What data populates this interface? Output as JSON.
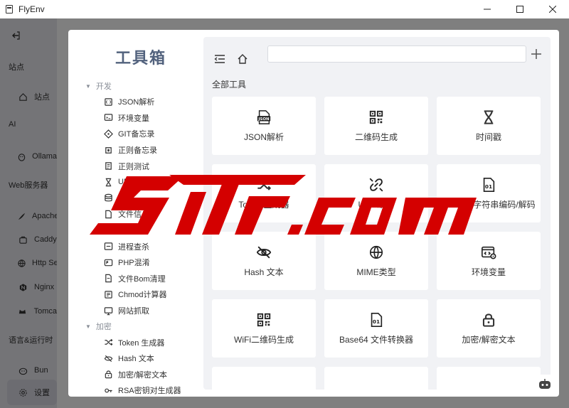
{
  "window": {
    "title": "FlyEnv"
  },
  "sidebar": {
    "items": [
      {
        "type": "icon",
        "icon": "back-icon"
      },
      {
        "type": "section",
        "label": "站点"
      },
      {
        "type": "item",
        "icon": "home-icon",
        "label": "站点"
      },
      {
        "type": "section",
        "label": "AI"
      },
      {
        "type": "item",
        "icon": "ollama-icon",
        "label": "Ollama"
      },
      {
        "type": "section",
        "label": "Web服务器"
      },
      {
        "type": "item",
        "icon": "apache-icon",
        "label": "Apache"
      },
      {
        "type": "item",
        "icon": "caddy-icon",
        "label": "Caddy"
      },
      {
        "type": "item",
        "icon": "globe-icon",
        "label": "Http Se"
      },
      {
        "type": "item",
        "icon": "nginx-icon",
        "label": "Nginx"
      },
      {
        "type": "item",
        "icon": "tomcat-icon",
        "label": "Tomca"
      },
      {
        "type": "section",
        "label": "语言&运行时"
      },
      {
        "type": "item",
        "icon": "bun-icon",
        "label": "Bun"
      },
      {
        "type": "item",
        "icon": "gear-icon",
        "label": "设置",
        "active": true
      }
    ]
  },
  "toolbox": {
    "title": "工具箱",
    "tree": [
      {
        "group": "开发",
        "items": [
          {
            "icon": "json-icon",
            "label": "JSON解析"
          },
          {
            "icon": "env-icon",
            "label": "环境变量"
          },
          {
            "icon": "git-icon",
            "label": "GIT备忘录"
          },
          {
            "icon": "regex-icon",
            "label": "正则备忘录"
          },
          {
            "icon": "regex-test-icon",
            "label": "正则测试"
          },
          {
            "icon": "hourglass-icon",
            "label": "UR"
          },
          {
            "icon": "db-icon",
            "label": ""
          },
          {
            "icon": "file-icon",
            "label": "文件信息"
          },
          {
            "icon": "port-icon",
            "label": ""
          },
          {
            "icon": "terminal-icon",
            "label": "进程查杀"
          },
          {
            "icon": "php-icon",
            "label": "PHP混淆"
          },
          {
            "icon": "bom-icon",
            "label": "文件Bom清理"
          },
          {
            "icon": "chmod-icon",
            "label": "Chmod计算器"
          },
          {
            "icon": "web-grab-icon",
            "label": "网站抓取"
          }
        ]
      },
      {
        "group": "加密",
        "items": [
          {
            "icon": "shuffle-icon",
            "label": "Token 生成器"
          },
          {
            "icon": "hash-icon",
            "label": "Hash 文本"
          },
          {
            "icon": "lock-icon",
            "label": "加密/解密文本"
          },
          {
            "icon": "key-icon",
            "label": "RSA密钥对生成器"
          }
        ]
      }
    ],
    "search": {
      "placeholder": ""
    },
    "section_title": "全部工具",
    "cards": [
      {
        "icon": "json-file-icon",
        "label": "JSON解析"
      },
      {
        "icon": "qrcode-icon",
        "label": "二维码生成"
      },
      {
        "icon": "hourglass-icon",
        "label": "时间戳"
      },
      {
        "icon": "shuffle-icon",
        "label": "Token 生成器"
      },
      {
        "icon": "link-icon",
        "label": "URL 编码"
      },
      {
        "icon": "file-01-icon",
        "label": "Base64 字符串编码/解码"
      },
      {
        "icon": "eye-off-icon",
        "label": "Hash 文本"
      },
      {
        "icon": "globe-icon",
        "label": "MIME类型"
      },
      {
        "icon": "code-gear-icon",
        "label": "环境变量"
      },
      {
        "icon": "qrcode-icon",
        "label": "WiFi二维码生成"
      },
      {
        "icon": "file-01-icon",
        "label": "Base64 文件转换器"
      },
      {
        "icon": "lock-icon",
        "label": "加密/解密文本"
      },
      {
        "icon": "blank-icon",
        "label": ""
      },
      {
        "icon": "blank-icon",
        "label": ""
      },
      {
        "icon": "blank-icon",
        "label": ""
      }
    ]
  },
  "watermark": {
    "text": "5iLr.com"
  },
  "colors": {
    "title": "#52627d",
    "watermark": "#d40000",
    "panel": "#f1f2f5"
  }
}
